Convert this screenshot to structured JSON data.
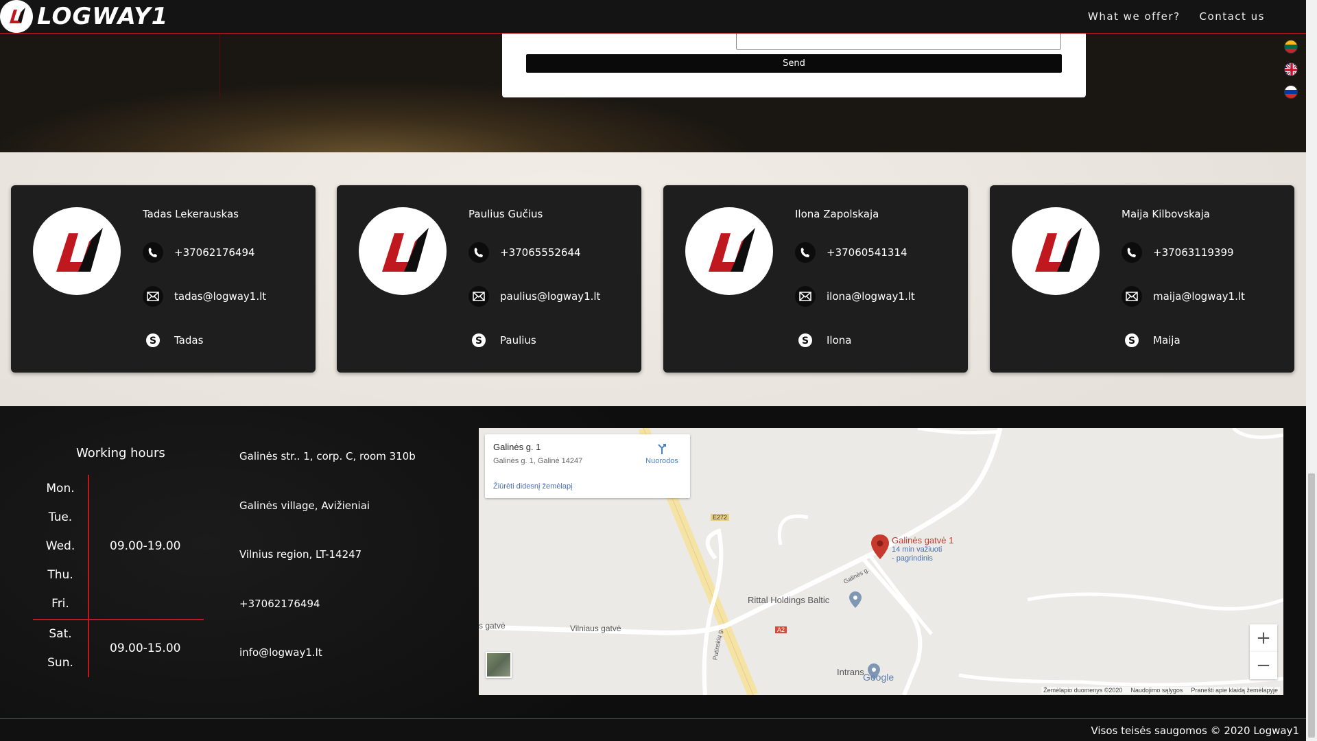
{
  "header": {
    "logo_text": "LOGWAY1",
    "nav": [
      "What we offer?",
      "Contact us"
    ]
  },
  "languages": [
    "lt-flag-icon",
    "gb-flag-icon",
    "ru-flag-icon"
  ],
  "form": {
    "send_label": "Send"
  },
  "team": [
    {
      "name": "Tadas Lekerauskas",
      "phone": "+37062176494",
      "email": "tadas@logway1.lt",
      "skype": "Tadas"
    },
    {
      "name": "Paulius Gučius",
      "phone": "+37065552644",
      "email": "paulius@logway1.lt",
      "skype": "Paulius"
    },
    {
      "name": "Ilona Zapolskaja",
      "phone": "+37060541314",
      "email": "ilona@logway1.lt",
      "skype": "Ilona"
    },
    {
      "name": "Maija Kilbovskaja",
      "phone": "+37063119399",
      "email": "maija@logway1.lt",
      "skype": "Maija"
    }
  ],
  "working_hours": {
    "title": "Working hours",
    "weekdays": [
      "Mon.",
      "Tue.",
      "Wed.",
      "Thu.",
      "Fri."
    ],
    "weekday_hours": "09.00-19.00",
    "weekend": [
      "Sat.",
      "Sun."
    ],
    "weekend_hours": "09.00-15.00"
  },
  "address": {
    "line1": "Galinės str.. 1, corp. C, room 310b",
    "line2": "Galinės village, Avižieniai",
    "line3": "Vilnius region, LT-14247",
    "phone": "+37062176494",
    "email": "info@logway1.lt"
  },
  "map": {
    "info_title": "Galinės g. 1",
    "info_sub": "Galinės g. 1, Galinė 14247",
    "info_link": "Žiūrėti didesnį žemėlapį",
    "directions": "Nuorodos",
    "pin_title": "Galinės gatvė 1",
    "pin_sub1": "14 min važiuoti",
    "pin_sub2": "- pagrindinis",
    "place_rittal": "Rittal Holdings Baltic",
    "place_intrans": "Intrans",
    "street_vilniaus": "Vilniaus gatvė",
    "street_gatve": "s gatvė",
    "street_galines": "Galinės g.",
    "street_putinskiu": "Putinskių g.",
    "road_e272": "E272",
    "road_a2": "A2",
    "google": "Google",
    "footer": [
      "Žemėlapio duomenys ©2020",
      "Naudojimo sąlygos",
      "Pranešti apie klaidą žemėlapyje"
    ]
  },
  "copyright": "Visos teisės saugomos © 2020 Logway1"
}
